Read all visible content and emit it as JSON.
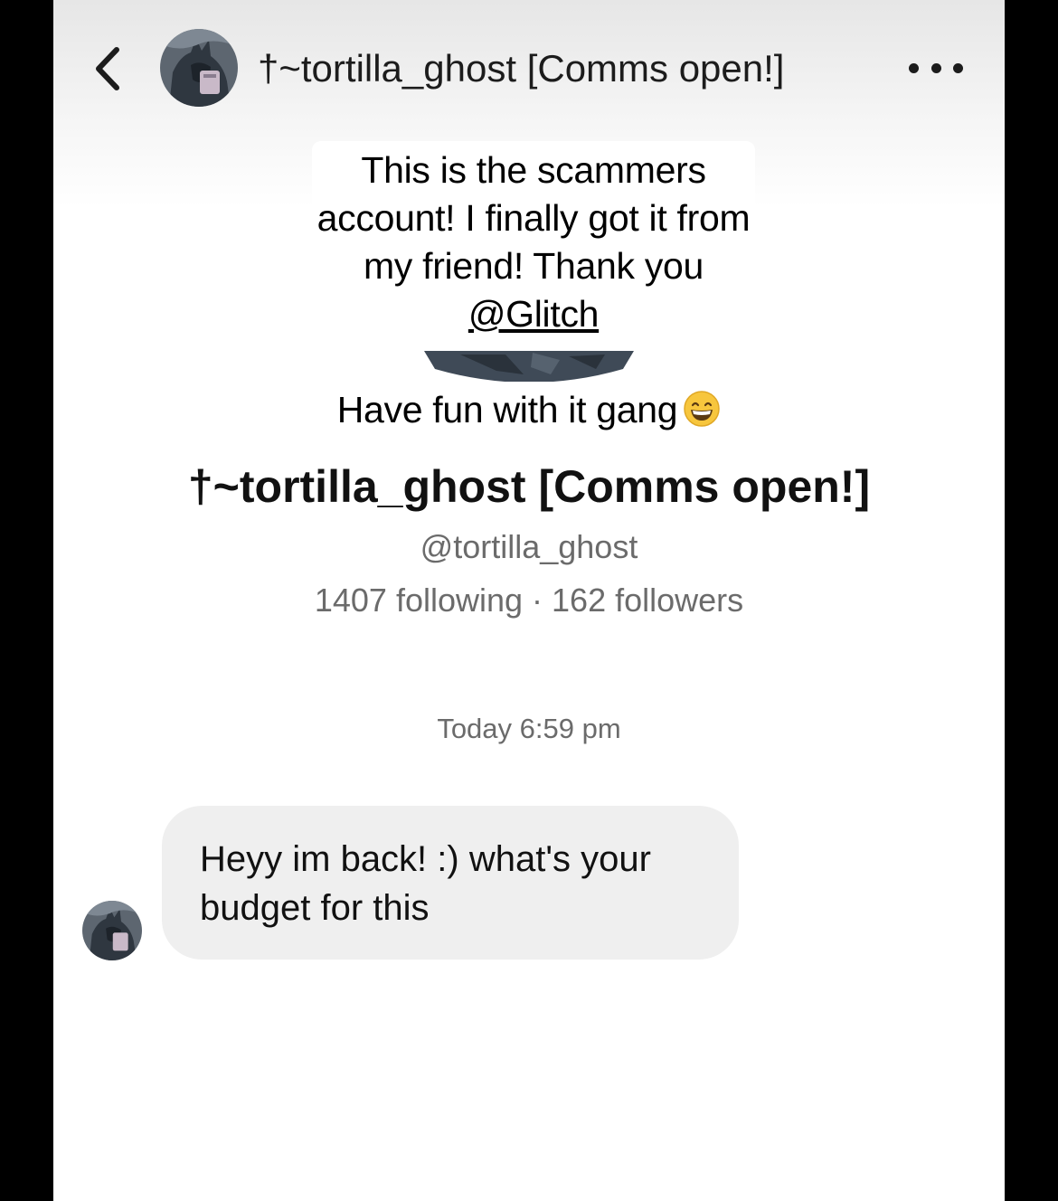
{
  "header": {
    "back_icon": "chevron-left-icon",
    "title": "†~tortilla_ghost [Comms open!]",
    "more_icon": "more-horizontal-icon"
  },
  "overlay": {
    "caption_line1": "This is the scammers account! I finally got it from my friend! Thank you ",
    "mention": "@Glitch",
    "caption_line2": "Have fun with it gang",
    "emoji": "grinning-face-icon"
  },
  "profile": {
    "name": "†~tortilla_ghost [Comms open!]",
    "handle": "@tortilla_ghost",
    "stats": "1407 following · 162 followers"
  },
  "conversation": {
    "timestamp": "Today 6:59 pm",
    "messages": [
      {
        "text": "Heyy im back! :) what's your budget for this"
      }
    ]
  },
  "colors": {
    "background": "#ffffff",
    "letterbox": "#000000",
    "bubble": "#efefef",
    "muted_text": "#6b6b6b"
  }
}
